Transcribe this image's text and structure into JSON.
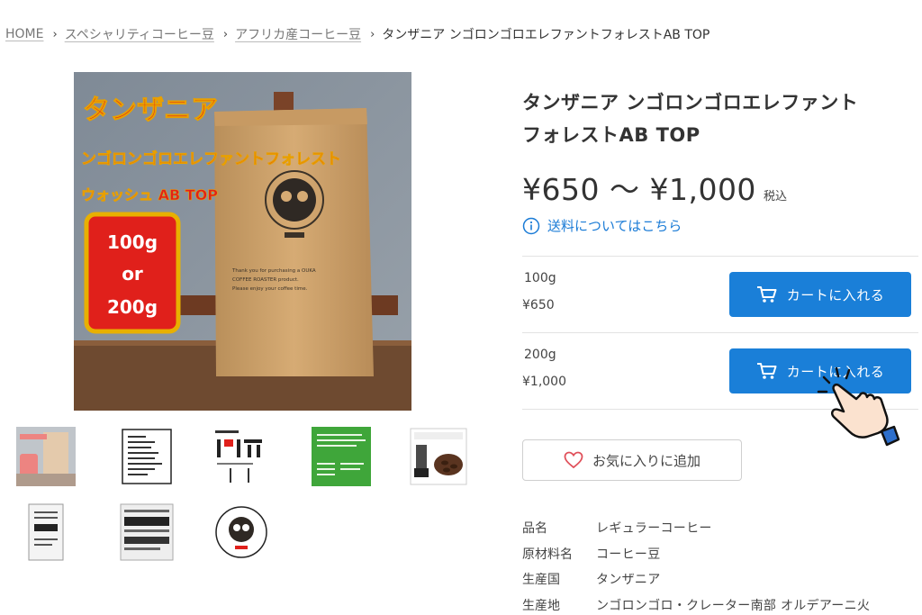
{
  "breadcrumb": {
    "items": [
      {
        "label": "HOME"
      },
      {
        "label": "スペシャリティコーヒー豆"
      },
      {
        "label": "アフリカ産コーヒー豆"
      },
      {
        "label": "タンザニア ンゴロンゴロエレファントフォレストAB TOP"
      }
    ],
    "separator": "›"
  },
  "product_image": {
    "text_line1": "タンザニア",
    "text_line2": "ンゴロンゴロエレファントフォレスト",
    "text_line3": "ウォッシュ AB  TOP",
    "badge_line1": "100g",
    "badge_line2": "or",
    "badge_line3": "200g",
    "label_text_1": "Thank you for purchasing a OUKA",
    "label_text_2": "COFFEE ROASTER product.",
    "label_text_3": "Please enjoy your coffee time."
  },
  "product": {
    "title_line1": "タンザニア ンゴロンゴロエレファント",
    "title_line2": "フォレストAB TOP",
    "price": "¥650 〜 ¥1,000",
    "tax_label": "税込",
    "shipping_link": "送料についてはこちら"
  },
  "variants": [
    {
      "name": "100g",
      "price": "¥650",
      "button": "カートに入れる"
    },
    {
      "name": "200g",
      "price": "¥1,000",
      "button": "カートに入れる"
    }
  ],
  "favorite_button": "お気に入りに追加",
  "specs": [
    {
      "key": "品名",
      "value": "レギュラーコーヒー"
    },
    {
      "key": "原材料名",
      "value": "コーヒー豆"
    },
    {
      "key": "生産国",
      "value": "タンザニア"
    },
    {
      "key": "生産地",
      "value": "ンゴロンゴロ・クレーター南部 オルデアーニ火"
    }
  ],
  "colors": {
    "accent": "#1a7fd8",
    "link": "#1a7bd6",
    "heart": "#e0505a",
    "image_title": "#e0201b"
  },
  "icons": {
    "info": "info-icon",
    "cart": "cart-icon",
    "heart": "heart-icon",
    "hand": "hand-pointer-icon"
  }
}
